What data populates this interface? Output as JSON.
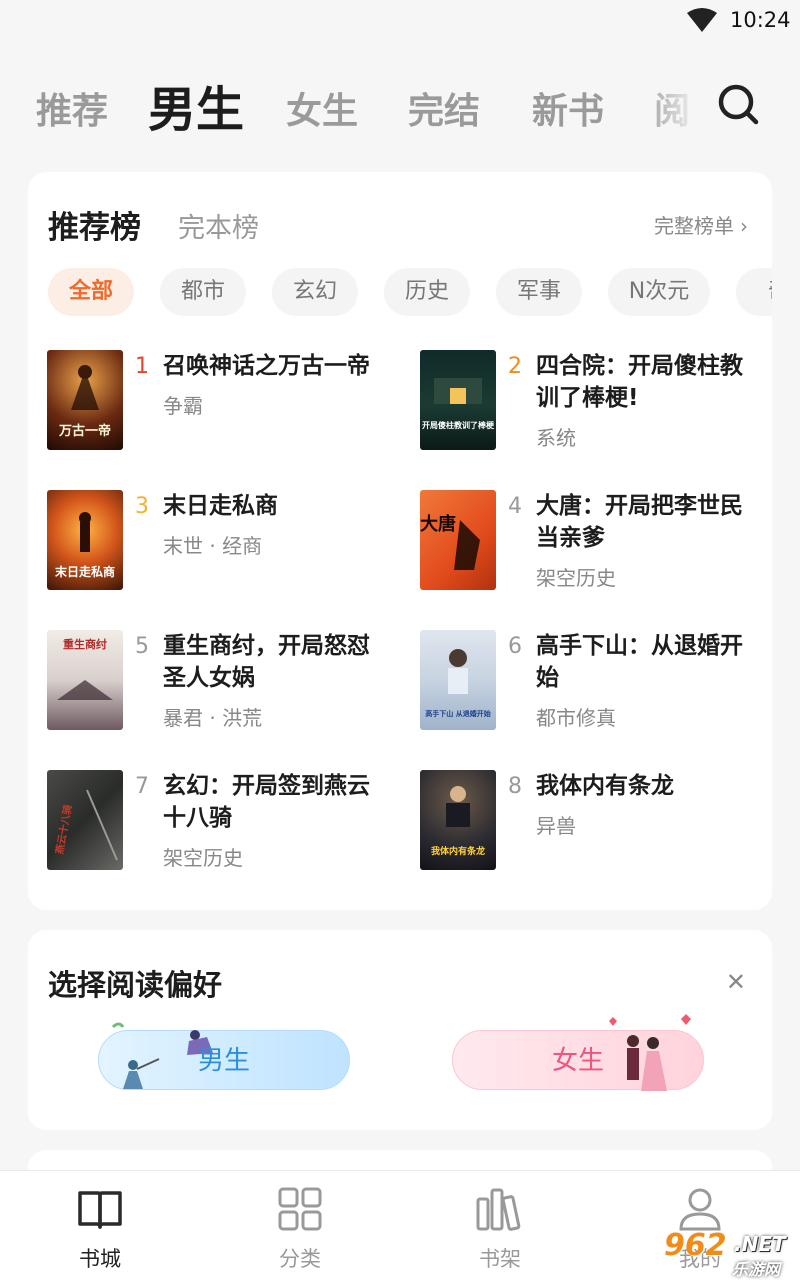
{
  "status_bar": {
    "time": "10:24",
    "wifi_icon": "wifi-icon"
  },
  "top_nav": {
    "tabs": [
      "推荐",
      "男生",
      "女生",
      "完结",
      "新书",
      "阅"
    ],
    "active_tab": "男生",
    "search_icon": "search-icon"
  },
  "ranking": {
    "tab_main": "推荐榜",
    "tab_alt": "完本榜",
    "more_label": "完整榜单",
    "chips": [
      "全部",
      "都市",
      "玄幻",
      "历史",
      "军事",
      "N次元",
      "奇"
    ],
    "active_chip": "全部",
    "books": [
      {
        "rank": "1",
        "title": "召唤神话之万古一帝",
        "tag": "争霸",
        "cover_text": "万古一帝"
      },
      {
        "rank": "2",
        "title": "四合院：开局傻柱教训了棒梗!",
        "tag": "系统",
        "cover_text": "开局傻柱教训了棒梗"
      },
      {
        "rank": "3",
        "title": "末日走私商",
        "tag": "末世 · 经商",
        "cover_text": "末日走私商"
      },
      {
        "rank": "4",
        "title": "大唐：开局把李世民当亲爹",
        "tag": "架空历史",
        "cover_text": "大唐"
      },
      {
        "rank": "5",
        "title": "重生商纣，开局怒怼圣人女娲",
        "tag": "暴君 · 洪荒",
        "cover_text": "重生商纣"
      },
      {
        "rank": "6",
        "title": "高手下山：从退婚开始",
        "tag": "都市修真",
        "cover_text": "高手下山 从退婚开始"
      },
      {
        "rank": "7",
        "title": "玄幻：开局签到燕云十八骑",
        "tag": "架空历史",
        "cover_text": "燕云十八骑"
      },
      {
        "rank": "8",
        "title": "我体内有条龙",
        "tag": "异兽",
        "cover_text": "我体内有条龙"
      }
    ],
    "rank_colors": {
      "1": "#e8432f",
      "2": "#f08a1c",
      "3": "#f5b12a",
      "other": "#999999"
    }
  },
  "preference": {
    "title": "选择阅读偏好",
    "close_icon": "close-icon",
    "male_label": "男生",
    "female_label": "女生"
  },
  "bottom_nav": {
    "items": [
      {
        "label": "书城",
        "icon": "book-open-icon"
      },
      {
        "label": "分类",
        "icon": "grid-icon"
      },
      {
        "label": "书架",
        "icon": "bookshelf-icon"
      },
      {
        "label": "我的",
        "icon": "user-icon"
      }
    ],
    "active": "书城"
  },
  "watermark": {
    "brand": "962",
    "domain": ".NET",
    "site": "乐游网"
  },
  "colors": {
    "accent": "#f06a2a",
    "male": "#2b8fe0",
    "female": "#f0557e",
    "background": "#f6f6f6"
  }
}
